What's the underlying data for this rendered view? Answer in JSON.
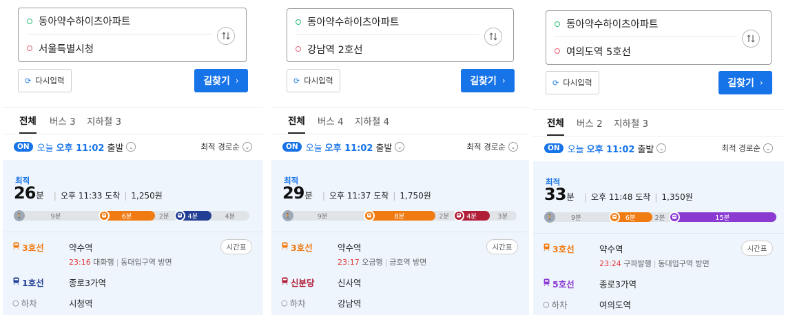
{
  "panels": [
    {
      "origin": "동아약수하이츠아파트",
      "destination": "서울특별시청",
      "reset_label": "다시입력",
      "find_label": "길찾기",
      "tabs": [
        {
          "label": "전체"
        },
        {
          "label": "버스 3"
        },
        {
          "label": "지하철 3"
        }
      ],
      "on_label": "ON",
      "today": "오늘",
      "time": "오후 11:02",
      "depart": "출발",
      "sort": "최적 경로순",
      "best_label": "최적",
      "duration_min": "26",
      "duration_unit": "분",
      "arrival": "오후 11:33 도착",
      "fare": "1,250원",
      "segments": [
        {
          "type": "walk",
          "label": "9분",
          "minutes": 9
        },
        {
          "type": "subway",
          "label": "6분",
          "minutes": 6,
          "color": "#f07b12"
        },
        {
          "type": "walk",
          "label": "2분",
          "minutes": 2
        },
        {
          "type": "subway",
          "label": "4분",
          "minutes": 4,
          "color": "#223f93"
        },
        {
          "type": "walk",
          "label": "4분",
          "minutes": 4
        }
      ],
      "steps": [
        {
          "line": "3호선",
          "color": "#f07b12",
          "station": "약수역",
          "detail_time": "23:16",
          "detail_dest": "대화행",
          "detail_dir": "동대입구역 방면",
          "timetable": "시간표"
        },
        {
          "line": "1호선",
          "color": "#223f93",
          "station": "종로3가역"
        },
        {
          "line": "하차",
          "color": "#777777",
          "station": "시청역"
        }
      ]
    },
    {
      "origin": "동아약수하이츠아파트",
      "destination": "강남역 2호선",
      "reset_label": "다시입력",
      "find_label": "길찾기",
      "tabs": [
        {
          "label": "전체"
        },
        {
          "label": "버스 4"
        },
        {
          "label": "지하철 4"
        }
      ],
      "on_label": "ON",
      "today": "오늘",
      "time": "오후 11:02",
      "depart": "출발",
      "sort": "최적 경로순",
      "best_label": "최적",
      "duration_min": "29",
      "duration_unit": "분",
      "arrival": "오후 11:37 도착",
      "fare": "1,750원",
      "segments": [
        {
          "type": "walk",
          "label": "9분",
          "minutes": 9
        },
        {
          "type": "subway",
          "label": "8분",
          "minutes": 8,
          "color": "#f07b12"
        },
        {
          "type": "walk",
          "label": "2분",
          "minutes": 2
        },
        {
          "type": "subway",
          "label": "4분",
          "minutes": 4,
          "color": "#b01e38"
        },
        {
          "type": "walk",
          "label": "3분",
          "minutes": 3
        }
      ],
      "steps": [
        {
          "line": "3호선",
          "color": "#f07b12",
          "station": "약수역",
          "detail_time": "23:17",
          "detail_dest": "오금행",
          "detail_dir": "금호역 방면",
          "timetable": "시간표"
        },
        {
          "line": "신분당",
          "color": "#b01e38",
          "station": "신사역"
        },
        {
          "line": "하차",
          "color": "#777777",
          "station": "강남역"
        }
      ]
    },
    {
      "origin": "동아약수하이츠아파트",
      "destination": "여의도역 5호선",
      "reset_label": "다시입력",
      "find_label": "길찾기",
      "tabs": [
        {
          "label": "전체"
        },
        {
          "label": "버스 2"
        },
        {
          "label": "지하철 3"
        }
      ],
      "on_label": "ON",
      "today": "오늘",
      "time": "오후 11:02",
      "depart": "출발",
      "sort": "최적 경로순",
      "best_label": "최적",
      "duration_min": "33",
      "duration_unit": "분",
      "arrival": "오후 11:48 도착",
      "fare": "1,350원",
      "segments": [
        {
          "type": "walk",
          "label": "9분",
          "minutes": 9
        },
        {
          "type": "subway",
          "label": "6분",
          "minutes": 6,
          "color": "#f07b12"
        },
        {
          "type": "walk",
          "label": "2분",
          "minutes": 2
        },
        {
          "type": "subway",
          "label": "15분",
          "minutes": 15,
          "color": "#8b3bd1"
        }
      ],
      "steps": [
        {
          "line": "3호선",
          "color": "#f07b12",
          "station": "약수역",
          "detail_time": "23:24",
          "detail_dest": "구파발행",
          "detail_dir": "동대입구역 방면",
          "timetable": "시간표"
        },
        {
          "line": "5호선",
          "color": "#8b3bd1",
          "station": "종로3가역"
        },
        {
          "line": "하차",
          "color": "#777777",
          "station": "여의도역"
        }
      ]
    }
  ]
}
